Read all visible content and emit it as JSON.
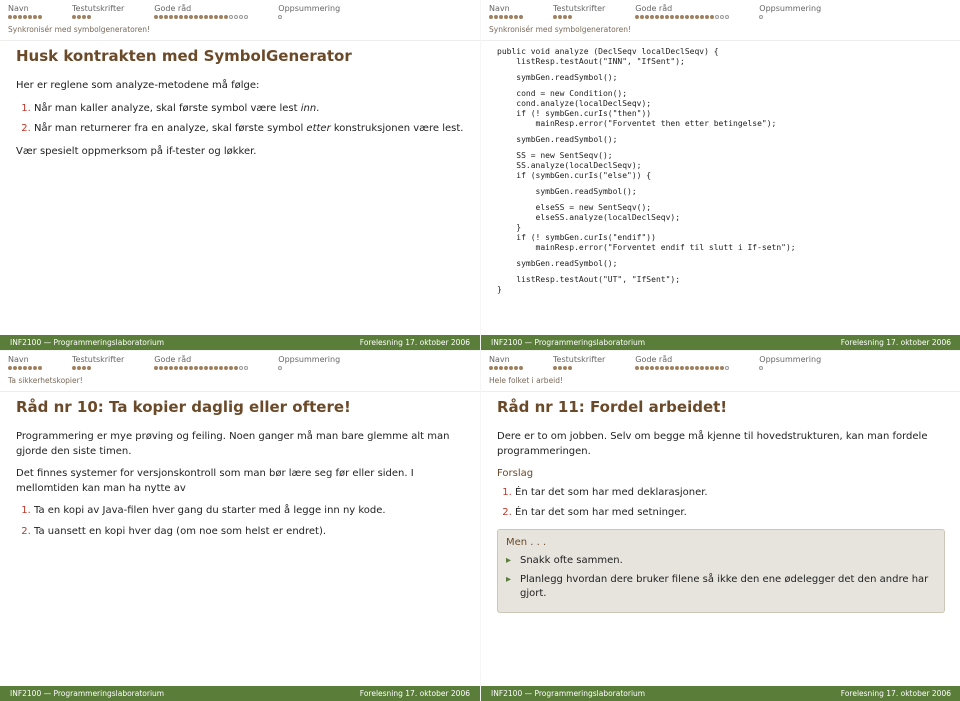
{
  "nav": {
    "items": [
      "Navn",
      "Testutskrifter",
      "Gode råd",
      "Oppsummering"
    ]
  },
  "footer": {
    "left": "INF2100 — Programmeringslaboratorium",
    "right": "Forelesning 17. oktober 2006"
  },
  "slide1": {
    "crumb": "Synkronisér med symbolgeneratoren!",
    "title": "Husk kontrakten med SymbolGenerator",
    "intro": "Her er reglene som analyze-metodene må følge:",
    "li1a": "Når man kaller analyze, skal første symbol være lest ",
    "li1b": "inn",
    "li1c": ".",
    "li2a": "Når man returnerer fra en analyze, skal første symbol ",
    "li2b": "etter",
    "li2c": " konstruksjonen være lest.",
    "outro": "Vær spesielt oppmerksom på if-tester og løkker."
  },
  "slide2": {
    "crumb": "Synkronisér med symbolgeneratoren!",
    "code_black_1": "public void analyze (DeclSeqv localDeclSeqv) {\n    listResp.testAout(\"INN\", \"IfSent\");",
    "code_red_1": "    symbGen.readSymbol();",
    "code_black_2": "    cond = new Condition();\n    cond.analyze(localDeclSeqv);\n    if (! symbGen.curIs(\"then\"))\n        mainResp.error(\"Forventet then etter betingelse\");",
    "code_red_2": "    symbGen.readSymbol();",
    "code_black_3": "    SS = new SentSeqv();\n    SS.analyze(localDeclSeqv);\n    if (symbGen.curIs(\"else\")) {",
    "code_red_3": "        symbGen.readSymbol();",
    "code_black_4": "        elseSS = new SentSeqv();\n        elseSS.analyze(localDeclSeqv);\n    }\n    if (! symbGen.curIs(\"endif\"))\n        mainResp.error(\"Forventet endif til slutt i If-setn\");",
    "code_red_4": "    symbGen.readSymbol();",
    "code_black_5": "    listResp.testAout(\"UT\", \"IfSent\");\n}"
  },
  "slide3": {
    "crumb": "Ta sikkerhetskopier!",
    "title": "Råd nr 10: Ta kopier daglig eller oftere!",
    "p1": "Programmering er mye prøving og feiling. Noen ganger må man bare glemme alt man gjorde den siste timen.",
    "p2": "Det finnes systemer for versjonskontroll som man bør lære seg før eller siden. I mellomtiden kan man ha nytte av",
    "li1": "Ta en kopi av Java-filen hver gang du starter med å legge inn ny kode.",
    "li2": "Ta uansett en kopi hver dag (om noe som helst er endret)."
  },
  "slide4": {
    "crumb": "Hele folket i arbeid!",
    "title": "Råd nr 11: Fordel arbeidet!",
    "p1": "Dere er to om jobben. Selv om begge må kjenne til hovedstrukturen, kan man fordele programmeringen.",
    "forslag": "Forslag",
    "li1": "Én tar det som har med deklarasjoner.",
    "li2": "Én tar det som har med setninger.",
    "men": "Men . . .",
    "b1": "Snakk ofte sammen.",
    "b2": "Planlegg hvordan dere bruker filene så ikke den ene ødelegger det den andre har gjort."
  }
}
